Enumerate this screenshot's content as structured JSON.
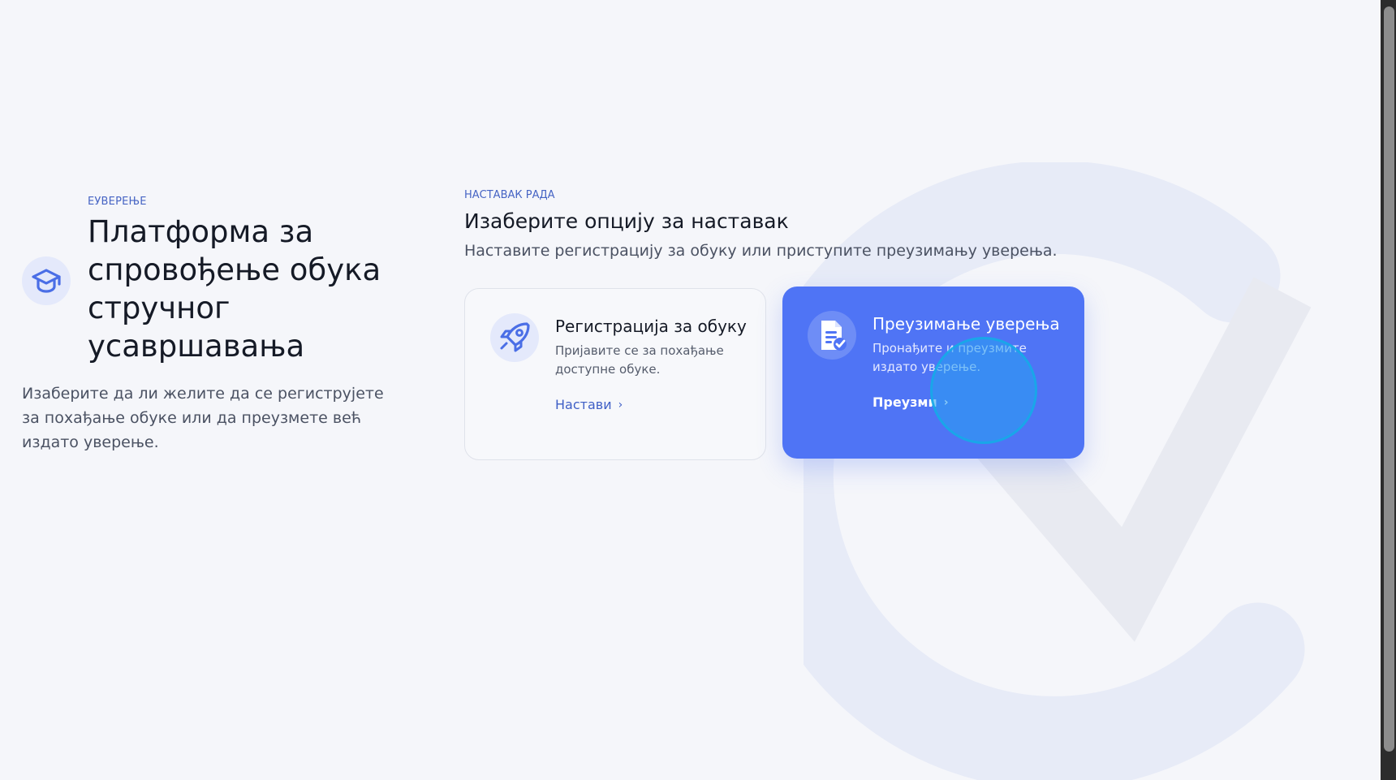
{
  "hero": {
    "kicker": "ЕУВЕРЕЊЕ",
    "title": "Платформа за спровођење обука стручног усавршавања",
    "description": "Изаберите да ли желите да се региструјете за похађање обуке или да преузмете већ издато уверење.",
    "icon": "graduation-cap-icon"
  },
  "section": {
    "kicker": "НАСТАВАК РАДА",
    "title": "Изаберите опцију за наставак",
    "subtitle": "Наставите регистрацију за обуку или приступите преузимању уверења."
  },
  "cards": [
    {
      "title": "Регистрација за обуку",
      "text": "Пријавите се за похађање доступне обуке.",
      "link": "Настави",
      "icon": "rocket-icon"
    },
    {
      "title": "Преузимање уверења",
      "text": "Пронађите и преузмите издато уверење.",
      "link": "Преузми",
      "icon": "certificate-icon"
    }
  ],
  "colors": {
    "accent": "#4f74f5",
    "kicker": "#4664c4",
    "background": "#f5f6fa"
  }
}
